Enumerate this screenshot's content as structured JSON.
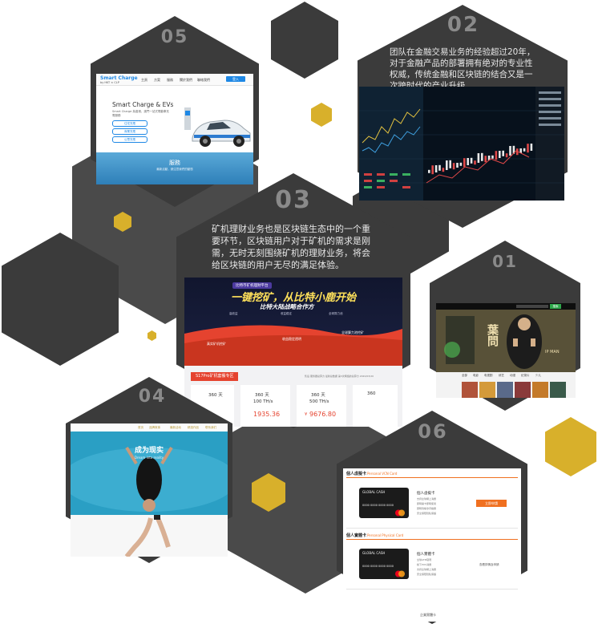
{
  "cards": [
    {
      "number": "05",
      "brand_logo": "Smart Charge",
      "brand_sub": "by HKT × CLP",
      "nav_items": [
        "主頁",
        "方案",
        "服務",
        "關於我們",
        "聯絡我們"
      ],
      "nav_button": "登入",
      "hero_title": "Smart Charge & EVs",
      "hero_lines": [
        "Smart Charge 為香港、澳門一站式電動車充",
        "電服務"
      ],
      "buttons": [
        "住宅充電",
        "商業充電",
        "公眾充電"
      ],
      "footer_title": "服務",
      "footer_sub": "最新活動，請注意我們的動態"
    },
    {
      "number": "02",
      "description": "团队在金融交易业务的经验超过20年，对于金融产品的部署拥有绝对的专业性权威，传统金融和区块链的结合又是一次跨时代的产业升级。"
    },
    {
      "number": "03",
      "description": "矿机理财业务也是区块链生态中的一个重要环节，区块链用户对于矿机的需求是刚需，无时无刻围绕矿机的理财业务，将会给区块链的用户无尽的满足体验。",
      "badge": "比特币矿机理财平台",
      "headline": "一键挖矿，从比特小鹿开始",
      "subline": "比特大陆战略合作方",
      "features": [
        "高收益",
        "收益稳定",
        "全球算力池"
      ],
      "card_left_title": "真实矿机挖矿",
      "card_mid_title": "收益稳定透明",
      "card_right_title": "全球算力池挖矿",
      "section_title": "S17Pro矿机套餐专区",
      "section_right": "售后  服务器总算力  最新总数据   第3次网络的总算力 2020/03/20",
      "plans": [
        {
          "days": "360 天",
          "power": "",
          "price": ""
        },
        {
          "days": "360 天",
          "power": "100 TH/s",
          "price": "1935.36"
        },
        {
          "days": "360 天",
          "power": "500 TH/s",
          "price": "9676.80"
        },
        {
          "days": "360",
          "power": "",
          "price": ""
        }
      ],
      "plan_currency": "¥"
    },
    {
      "number": "01",
      "search_button": "搜索",
      "poster_title": "葉問",
      "poster_sub": "IP MAN",
      "menu_items": [
        "全部",
        "电影",
        "电视剧",
        "综艺",
        "动漫",
        "纪录片",
        "少儿"
      ]
    },
    {
      "number": "04",
      "nav_items": [
        "首页",
        "品牌故事",
        "最新活动",
        "精选作品",
        "联系我们"
      ],
      "hero_title": "成为现实",
      "hero_sub": "Dream into reality"
    },
    {
      "number": "06",
      "section1_title": "個人虛擬卡",
      "section1_en": "Personal VCN Card",
      "card_brand": "GLOBAL CASH",
      "card_number": "0000 0000 0000 0000",
      "card1_title": "個人虛擬卡",
      "card1_items": [
        "支持全球網上消費",
        "即時開卡即時使用",
        "實時到帳零手續費",
        "安全保障隱私保護"
      ],
      "card1_button": "立即申請",
      "section2_title": "個人實體卡",
      "section2_en": "Personal Physical Card",
      "card2_title": "個人實體卡",
      "card2_items": [
        "全球ATM取現",
        "線下POS消費",
        "支持全球網上消費",
        "安全保障隱私保護"
      ],
      "card2_link": "查看詳情及申請",
      "section3_title": "企業實體卡"
    }
  ],
  "colors": {
    "hex_dark": "#3b3b3b",
    "hex_mid": "#4a4a4a",
    "gold": "#d8b02b",
    "number_gray": "#8a8a8a",
    "accent_blue": "#1e88e5",
    "accent_red": "#e5432f",
    "accent_orange": "#f07020",
    "accent_green": "#2ea84a"
  }
}
